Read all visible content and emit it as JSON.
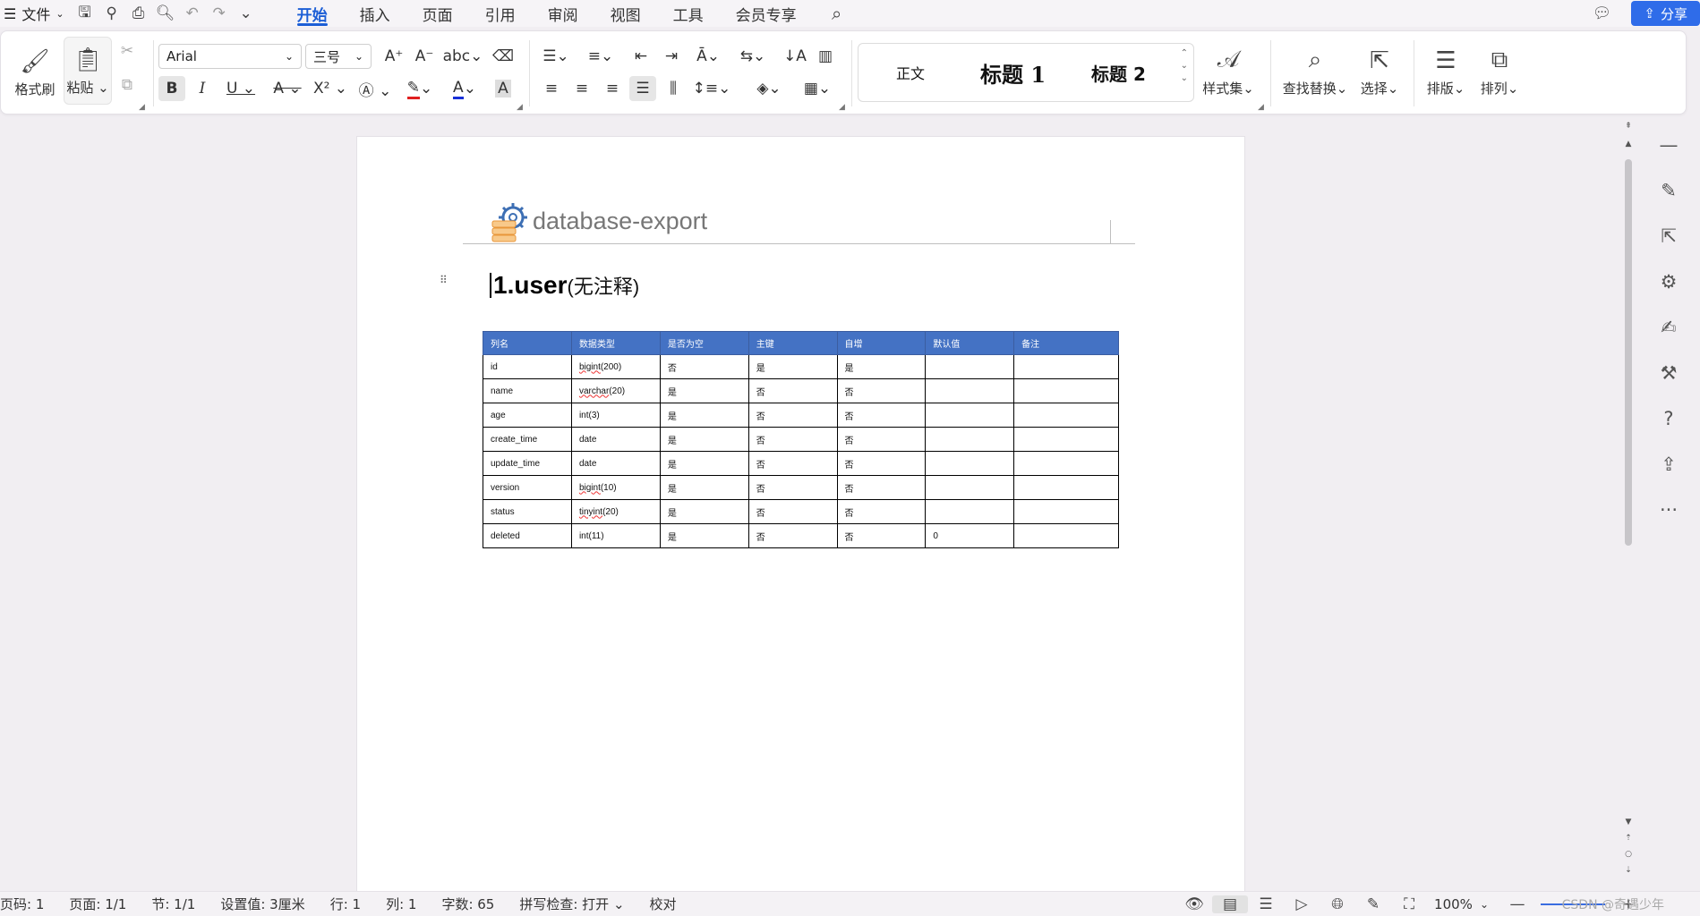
{
  "menubar": {
    "menu_label": "文件",
    "tabs": [
      "开始",
      "插入",
      "页面",
      "引用",
      "审阅",
      "视图",
      "工具",
      "会员专享"
    ],
    "active_tab": "开始",
    "share_label": "分享"
  },
  "ribbon": {
    "format_painter": "格式刷",
    "paste": "粘贴",
    "font_name": "Arial",
    "font_size": "三号",
    "styles": {
      "normal": "正文",
      "heading1": "标题 1",
      "heading2": "标题 2"
    },
    "style_set": "样式集",
    "find_replace": "查找替换",
    "select": "选择",
    "layout": "排版",
    "arrange": "排列"
  },
  "document": {
    "header_text": "database-export",
    "heading_main": "1.user",
    "heading_sub": "(无注释)",
    "table": {
      "columns": [
        "列名",
        "数据类型",
        "是否为空",
        "主键",
        "自增",
        "默认值",
        "备注"
      ],
      "rows": [
        [
          "id",
          "bigint(200)",
          "否",
          "是",
          "是",
          "",
          ""
        ],
        [
          "name",
          "varchar(20)",
          "是",
          "否",
          "否",
          "",
          ""
        ],
        [
          "age",
          "int(3)",
          "是",
          "否",
          "否",
          "",
          ""
        ],
        [
          "create_time",
          "date",
          "是",
          "否",
          "否",
          "",
          ""
        ],
        [
          "update_time",
          "date",
          "是",
          "否",
          "否",
          "",
          ""
        ],
        [
          "version",
          "bigint(10)",
          "是",
          "否",
          "否",
          "",
          ""
        ],
        [
          "status",
          "tinyint(20)",
          "是",
          "否",
          "否",
          "",
          ""
        ],
        [
          "deleted",
          "int(11)",
          "是",
          "否",
          "否",
          "0",
          ""
        ]
      ]
    }
  },
  "statusbar": {
    "page_num": "页码: 1",
    "pages": "页面: 1/1",
    "section": "节: 1/1",
    "setting": "设置值: 3厘米",
    "row": "行: 1",
    "col": "列: 1",
    "word_count": "字数: 65",
    "spell_check": "拼写检查: 打开",
    "proofread": "校对",
    "zoom": "100%",
    "watermark": "CSDN @奇遇少年"
  }
}
